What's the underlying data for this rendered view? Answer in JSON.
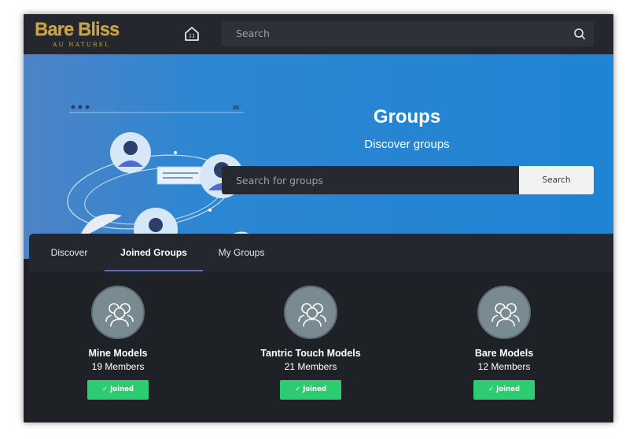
{
  "brand": {
    "name": "Bare Bliss",
    "tagline": "AU NATUREL"
  },
  "topbar": {
    "search_placeholder": "Search"
  },
  "hero": {
    "title": "Groups",
    "subtitle": "Discover groups",
    "search_placeholder": "Search for groups",
    "search_button": "Search"
  },
  "tabs": [
    {
      "label": "Discover",
      "active": false
    },
    {
      "label": "Joined Groups",
      "active": true
    },
    {
      "label": "My Groups",
      "active": false
    }
  ],
  "groups": [
    {
      "name": "Mine Models",
      "members": "19 Members",
      "status": "Joined"
    },
    {
      "name": "Tantric Touch Models",
      "members": "21 Members",
      "status": "Joined"
    },
    {
      "name": "Bare Models",
      "members": "12 Members",
      "status": "Joined"
    }
  ],
  "colors": {
    "brand_gold": "#c9a34e",
    "hero_blue": "#1f84d4",
    "joined_green": "#2ecc71",
    "tab_underline": "#4f6bd6",
    "page_bg": "#1e2226"
  },
  "icons": {
    "home": "home-icon",
    "search": "search-icon",
    "group": "group-icon",
    "check": "check-icon"
  }
}
